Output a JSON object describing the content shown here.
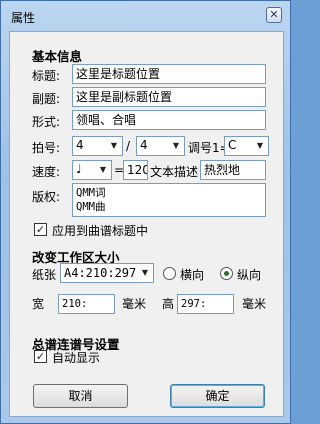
{
  "window": {
    "title": "属性",
    "close_glyph": "✕"
  },
  "basic": {
    "section_title": "基本信息",
    "title_label": "标题:",
    "title_value": "这里是标题位置",
    "subtitle_label": "副题:",
    "subtitle_value": "这里是副标题位置",
    "form_label": "形式:",
    "form_value": "领唱、合唱",
    "beat_label": "拍号:",
    "beat_numerator": "4",
    "beat_slash": "/",
    "beat_denominator": "4",
    "key_label": "调号1=",
    "key_value": "C",
    "tempo_label": "速度:",
    "tempo_note": "♩",
    "tempo_eq": "=",
    "tempo_value": "120",
    "tempo_text_label": "文本描述",
    "tempo_text_value": "热烈地",
    "copyright_label": "版权:",
    "copyright_line1": "QMM词",
    "copyright_line2": "QMM曲",
    "apply_title_label": "应用到曲谱标题中",
    "apply_title_checked": true
  },
  "workspace": {
    "section_title": "改变工作区大小",
    "paper_label": "纸张",
    "paper_value": "A4:210:297",
    "orient_landscape_label": "横向",
    "orient_portrait_label": "纵向",
    "orient_selected": "portrait",
    "width_label": "宽",
    "width_value": "210:",
    "width_unit": "毫米",
    "height_label": "高",
    "height_value": "297:",
    "height_unit": "毫米"
  },
  "score_line": {
    "section_title": "总谱连谱号设置",
    "auto_display_label": "自动显示",
    "auto_display_checked": true
  },
  "buttons": {
    "cancel": "取消",
    "ok": "确定"
  },
  "icons": {
    "checkmark": "✓",
    "dropdown": "▼"
  }
}
